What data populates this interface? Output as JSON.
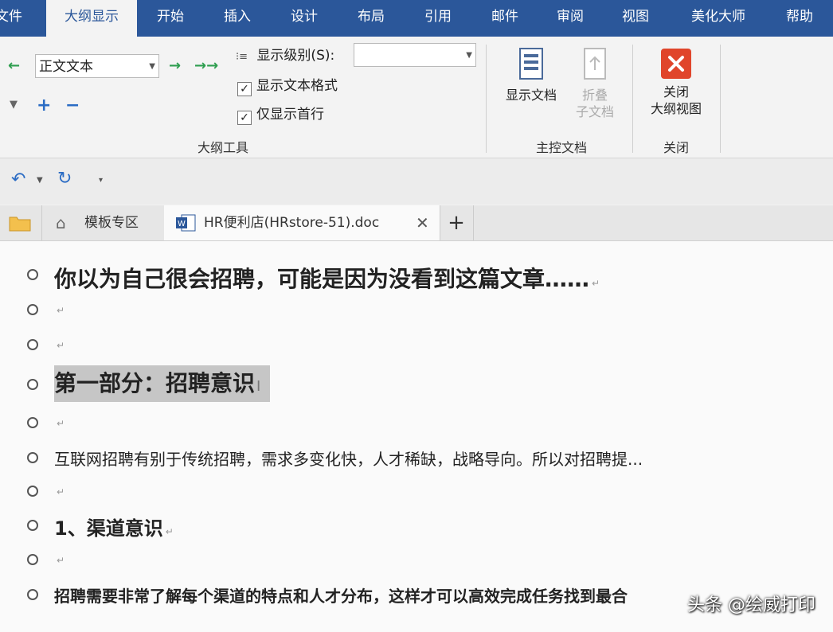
{
  "ribbon_tabs": [
    {
      "label": "文件"
    },
    {
      "label": "大纲显示",
      "active": true
    },
    {
      "label": "开始"
    },
    {
      "label": "插入"
    },
    {
      "label": "设计"
    },
    {
      "label": "布局"
    },
    {
      "label": "引用"
    },
    {
      "label": "邮件"
    },
    {
      "label": "审阅"
    },
    {
      "label": "视图"
    },
    {
      "label": "美化大师"
    },
    {
      "label": "帮助"
    }
  ],
  "outline_tools": {
    "level_combo_value": "正文文本",
    "show_level_label": "显示级别(S):",
    "show_level_value": "",
    "show_text_format_label": "显示文本格式",
    "show_text_format_checked": true,
    "first_line_only_label": "仅显示首行",
    "first_line_only_checked": true,
    "group_label": "大纲工具"
  },
  "master_document": {
    "show_document_label": "显示文档",
    "collapse_subdocs_line1": "折叠",
    "collapse_subdocs_line2": "子文档",
    "group_label": "主控文档"
  },
  "close_group": {
    "close_line1": "关闭",
    "close_line2": "大纲视图",
    "group_label": "关闭"
  },
  "doc_tabs": {
    "templates_label": "模板专区",
    "document_label": "HR便利店(HRstore-51).doc",
    "add_label": "+"
  },
  "outline_lines": [
    {
      "text": "你以为自己很会招聘，可能是因为没看到这篇文章……",
      "style": "h1"
    },
    {
      "text": "",
      "style": "empty"
    },
    {
      "text": "",
      "style": "empty"
    },
    {
      "text": "第一部分：招聘意识",
      "style": "h1",
      "selected": true
    },
    {
      "text": "",
      "style": "empty"
    },
    {
      "text": "互联网招聘有别于传统招聘，需求多变化快，人才稀缺，战略导向。所以对招聘提...",
      "style": "body"
    },
    {
      "text": "",
      "style": "empty"
    },
    {
      "text": "1、渠道意识",
      "style": "h2"
    },
    {
      "text": "",
      "style": "empty"
    },
    {
      "text": "招聘需要非常了解每个渠道的特点和人才分布，这样才可以高效完成任务找到最合",
      "style": "bodybold"
    }
  ],
  "paragraph_mark": "↵",
  "watermark": "头条 @绘威打印",
  "colors": {
    "ribbon_blue": "#2b579a",
    "close_red": "#e0452b",
    "arrow_green": "#2e9e4f",
    "plus_blue": "#2b6cc4"
  }
}
